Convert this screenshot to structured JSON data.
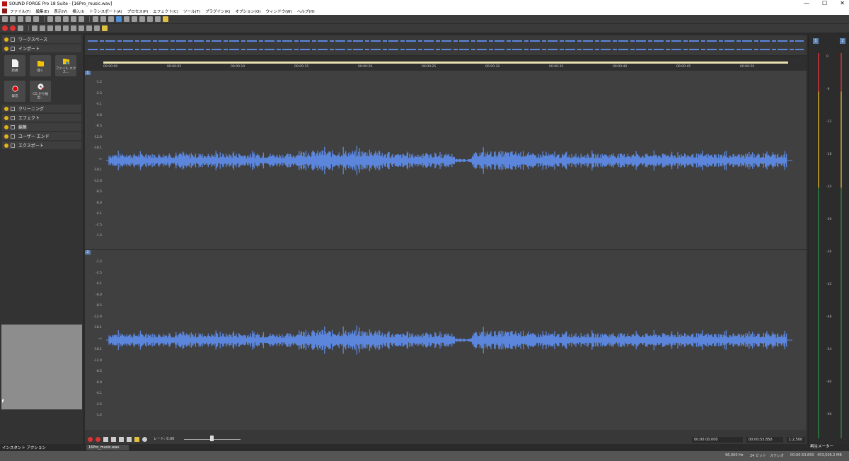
{
  "window": {
    "title": "SOUND FORGE Pro 18 Suite - [16Pro_music.wav]",
    "controls": [
      "—",
      "☐",
      "✕"
    ]
  },
  "menu": [
    "ファイル(F)",
    "編集(E)",
    "表示(V)",
    "挿入(I)",
    "トランスポート(A)",
    "プロセス(P)",
    "エフェクト(C)",
    "ツール(T)",
    "プラグイン(K)",
    "オプション(O)",
    "ウィンドウ(W)",
    "ヘルプ(H)"
  ],
  "left_panel": {
    "workspace": "ワークスペース",
    "import": "インポート",
    "tiles": [
      {
        "label": "新規",
        "icon": "new-file-icon"
      },
      {
        "label": "開く",
        "icon": "open-folder-icon"
      },
      {
        "label": "ファイル エクス...",
        "icon": "file-explorer-icon"
      },
      {
        "label": "録音",
        "icon": "record-icon"
      },
      {
        "label": "CD から抽出...",
        "icon": "cd-extract-icon"
      }
    ],
    "sections": [
      "クリーニング",
      "エフェクト",
      "編集",
      "ユーザー エンド",
      "エクスポート"
    ],
    "footer": "インスタント アクション"
  },
  "ruler": {
    "ticks": [
      "00:00:00",
      "00:00:05",
      "00:00:10",
      "00:00:15",
      "00:00:20",
      "00:00:25",
      "00:00:30",
      "00:00:35",
      "00:00:40",
      "00:00:45",
      "00:00:50"
    ]
  },
  "channels": [
    {
      "id": "1",
      "labels": [
        "-1.2",
        "-2.5",
        "-4.1",
        "-6.0",
        "-8.5",
        "-12.0",
        "-18.1",
        "-∞",
        "-18.1",
        "-12.0",
        "-8.5",
        "-6.0",
        "-4.1",
        "-2.5",
        "-1.2"
      ]
    },
    {
      "id": "2",
      "labels": [
        "-1.2",
        "-2.5",
        "-4.1",
        "-6.0",
        "-8.5",
        "-12.0",
        "-18.1",
        "-∞",
        "-18.1",
        "-12.0",
        "-8.5",
        "-6.0",
        "-4.1",
        "-2.5",
        "-1.2"
      ]
    }
  ],
  "transport": {
    "rate": "レート: 0.00",
    "position": "00:00:00.000",
    "length": "00:00:53.850",
    "zoom": "1:2,500"
  },
  "doc_tab": "16Pro_music.wav",
  "meter": {
    "footer": "再生メーター",
    "labels": [
      "0",
      "-6",
      "-12",
      "-18",
      "-24",
      "-30",
      "-36",
      "-42",
      "-48",
      "-54",
      "-60",
      "-66"
    ]
  },
  "status": {
    "rate": "96,000 Hz",
    "bits": "24 ビット",
    "mode": "ステレオ",
    "length": "00:00:53.850",
    "size": "453,506.2 MB"
  },
  "colors": {
    "wave": "#5b86dc",
    "accent": "#e3b11c"
  }
}
